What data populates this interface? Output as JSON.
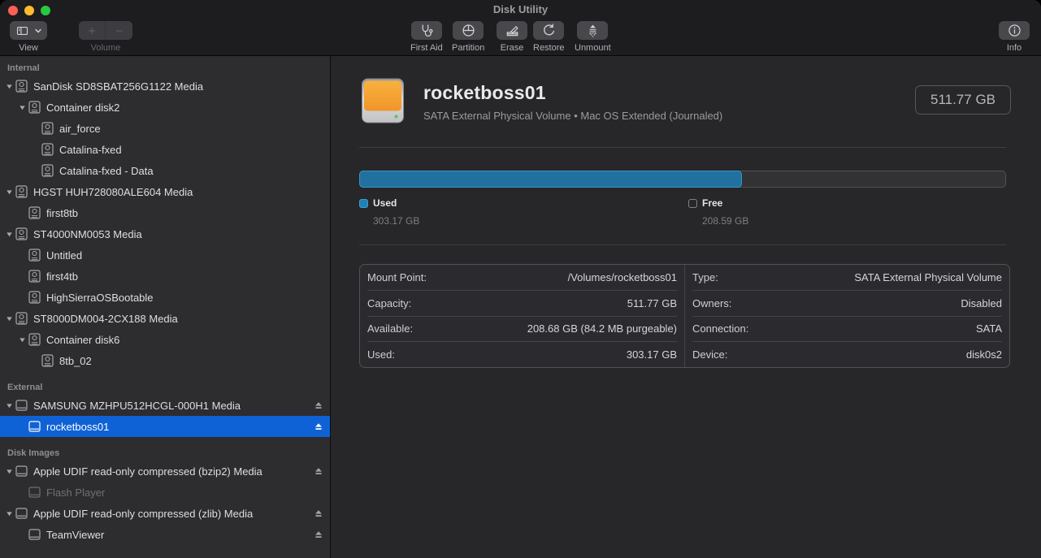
{
  "window": {
    "title": "Disk Utility"
  },
  "toolbar": {
    "view": {
      "label": "View",
      "icons": [
        "sidebar-icon",
        "chevron-down-icon"
      ]
    },
    "volume": {
      "label": "Volume",
      "add_icon": "plus-icon",
      "remove_icon": "minus-icon",
      "enabled": false
    },
    "tools": [
      {
        "label": "First Aid",
        "icon": "stethoscope-icon"
      },
      {
        "label": "Partition",
        "icon": "pie-chart-icon"
      },
      {
        "label": "Erase",
        "icon": "erase-pencil-icon"
      },
      {
        "label": "Restore",
        "icon": "restore-arrow-icon"
      },
      {
        "label": "Unmount",
        "icon": "unmount-eject-icon"
      }
    ],
    "info": {
      "label": "Info",
      "icon": "info-circle-icon"
    }
  },
  "sidebar": {
    "sections": [
      {
        "title": "Internal",
        "items": [
          {
            "label": "SanDisk SD8SBAT256G1122 Media",
            "level": 1,
            "disclosure": true,
            "icon": "internal"
          },
          {
            "label": "Container disk2",
            "level": 2,
            "disclosure": true,
            "icon": "internal"
          },
          {
            "label": "air_force",
            "level": 3,
            "disclosure": false,
            "icon": "internal"
          },
          {
            "label": "Catalina-fxed",
            "level": 3,
            "disclosure": false,
            "icon": "internal"
          },
          {
            "label": "Catalina-fxed - Data",
            "level": 3,
            "disclosure": false,
            "icon": "internal"
          },
          {
            "label": "HGST HUH728080ALE604 Media",
            "level": 1,
            "disclosure": true,
            "icon": "internal"
          },
          {
            "label": "first8tb",
            "level": 2,
            "disclosure": false,
            "icon": "internal"
          },
          {
            "label": "ST4000NM0053 Media",
            "level": 1,
            "disclosure": true,
            "icon": "internal"
          },
          {
            "label": "Untitled",
            "level": 2,
            "disclosure": false,
            "icon": "internal"
          },
          {
            "label": "first4tb",
            "level": 2,
            "disclosure": false,
            "icon": "internal"
          },
          {
            "label": "HighSierraOSBootable",
            "level": 2,
            "disclosure": false,
            "icon": "internal"
          },
          {
            "label": "ST8000DM004-2CX188 Media",
            "level": 1,
            "disclosure": true,
            "icon": "internal"
          },
          {
            "label": "Container disk6",
            "level": 2,
            "disclosure": true,
            "icon": "internal"
          },
          {
            "label": "8tb_02",
            "level": 3,
            "disclosure": false,
            "icon": "internal"
          }
        ]
      },
      {
        "title": "External",
        "items": [
          {
            "label": "SAMSUNG MZHPU512HCGL-000H1 Media",
            "level": 1,
            "disclosure": true,
            "icon": "external",
            "eject": true
          },
          {
            "label": "rocketboss01",
            "level": 2,
            "disclosure": false,
            "icon": "external",
            "eject": true,
            "selected": true
          }
        ]
      },
      {
        "title": "Disk Images",
        "items": [
          {
            "label": "Apple UDIF read-only compressed (bzip2) Media",
            "level": 1,
            "disclosure": true,
            "icon": "external",
            "eject": true
          },
          {
            "label": "Flash Player",
            "level": 2,
            "disclosure": false,
            "icon": "external",
            "disabled": true
          },
          {
            "label": "Apple UDIF read-only compressed (zlib) Media",
            "level": 1,
            "disclosure": true,
            "icon": "external",
            "eject": true
          },
          {
            "label": "TeamViewer",
            "level": 2,
            "disclosure": false,
            "icon": "external",
            "eject": true
          }
        ]
      }
    ]
  },
  "main": {
    "volume_icon": "orange-external-drive-icon",
    "title": "rocketboss01",
    "subtitle": "SATA External Physical Volume • Mac OS Extended (Journaled)",
    "size_badge": "511.77 GB",
    "usage": {
      "used_label": "Used",
      "used_value": "303.17 GB",
      "free_label": "Free",
      "free_value": "208.59 GB",
      "used_percent": 59.3
    },
    "details": {
      "left": [
        {
          "label": "Mount Point:",
          "value": "/Volumes/rocketboss01"
        },
        {
          "label": "Capacity:",
          "value": "511.77 GB"
        },
        {
          "label": "Available:",
          "value": "208.68 GB (84.2 MB purgeable)"
        },
        {
          "label": "Used:",
          "value": "303.17 GB"
        }
      ],
      "right": [
        {
          "label": "Type:",
          "value": "SATA External Physical Volume"
        },
        {
          "label": "Owners:",
          "value": "Disabled"
        },
        {
          "label": "Connection:",
          "value": "SATA"
        },
        {
          "label": "Device:",
          "value": "disk0s2"
        }
      ]
    }
  },
  "colors": {
    "selection_blue": "#0f62d6",
    "bar_used_fill": "#20719f",
    "bar_used_border": "#3496cb",
    "traffic_red": "#ff5f57",
    "traffic_yellow": "#febc2e",
    "traffic_green": "#28c840",
    "drive_icon_orange": "#f5a42d"
  }
}
